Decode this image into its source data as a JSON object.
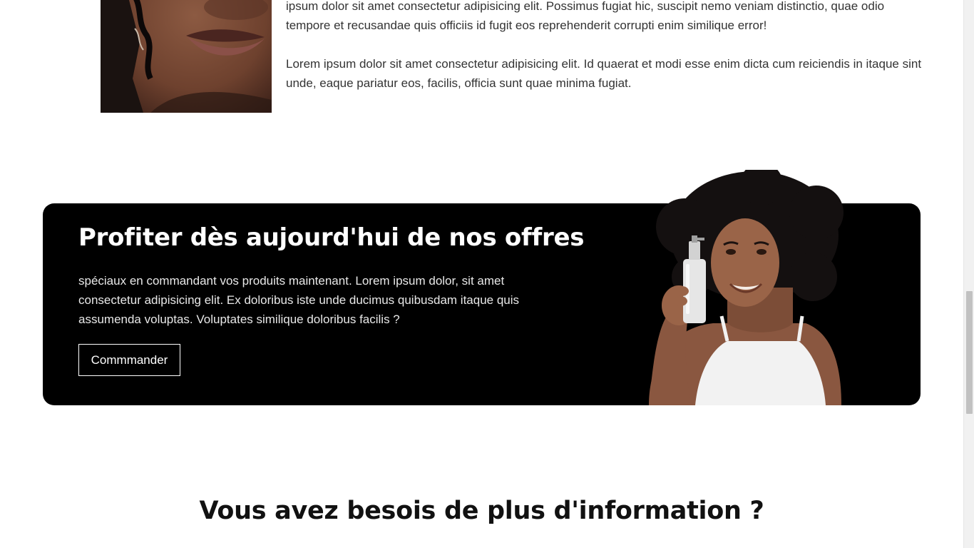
{
  "about": {
    "paragraph_1": "ipsum dolor sit amet consectetur adipisicing elit. Possimus fugiat hic, suscipit nemo veniam distinctio, quae odio tempore et recusandae quis officiis id fugit eos reprehenderit corrupti enim similique error!",
    "paragraph_2": "Lorem ipsum dolor sit amet consectetur adipisicing elit. Id quaerat et modi esse enim dicta cum reiciendis in itaque sint unde, eaque pariatur eos, facilis, officia sunt quae minima fugiat."
  },
  "offer": {
    "title": "Profiter dès aujourd'hui de nos offres",
    "description": "spéciaux en commandant vos produits maintenant. Lorem ipsum dolor, sit amet consectetur adipisicing elit. Ex doloribus iste unde ducimus quibusdam itaque quis assumenda voluptas. Voluptates similique doloribus facilis ?",
    "button_label": "Commmander"
  },
  "info": {
    "title": "Vous avez besois de plus d'information ?"
  },
  "scroll": {
    "position_fraction": 0.53
  }
}
